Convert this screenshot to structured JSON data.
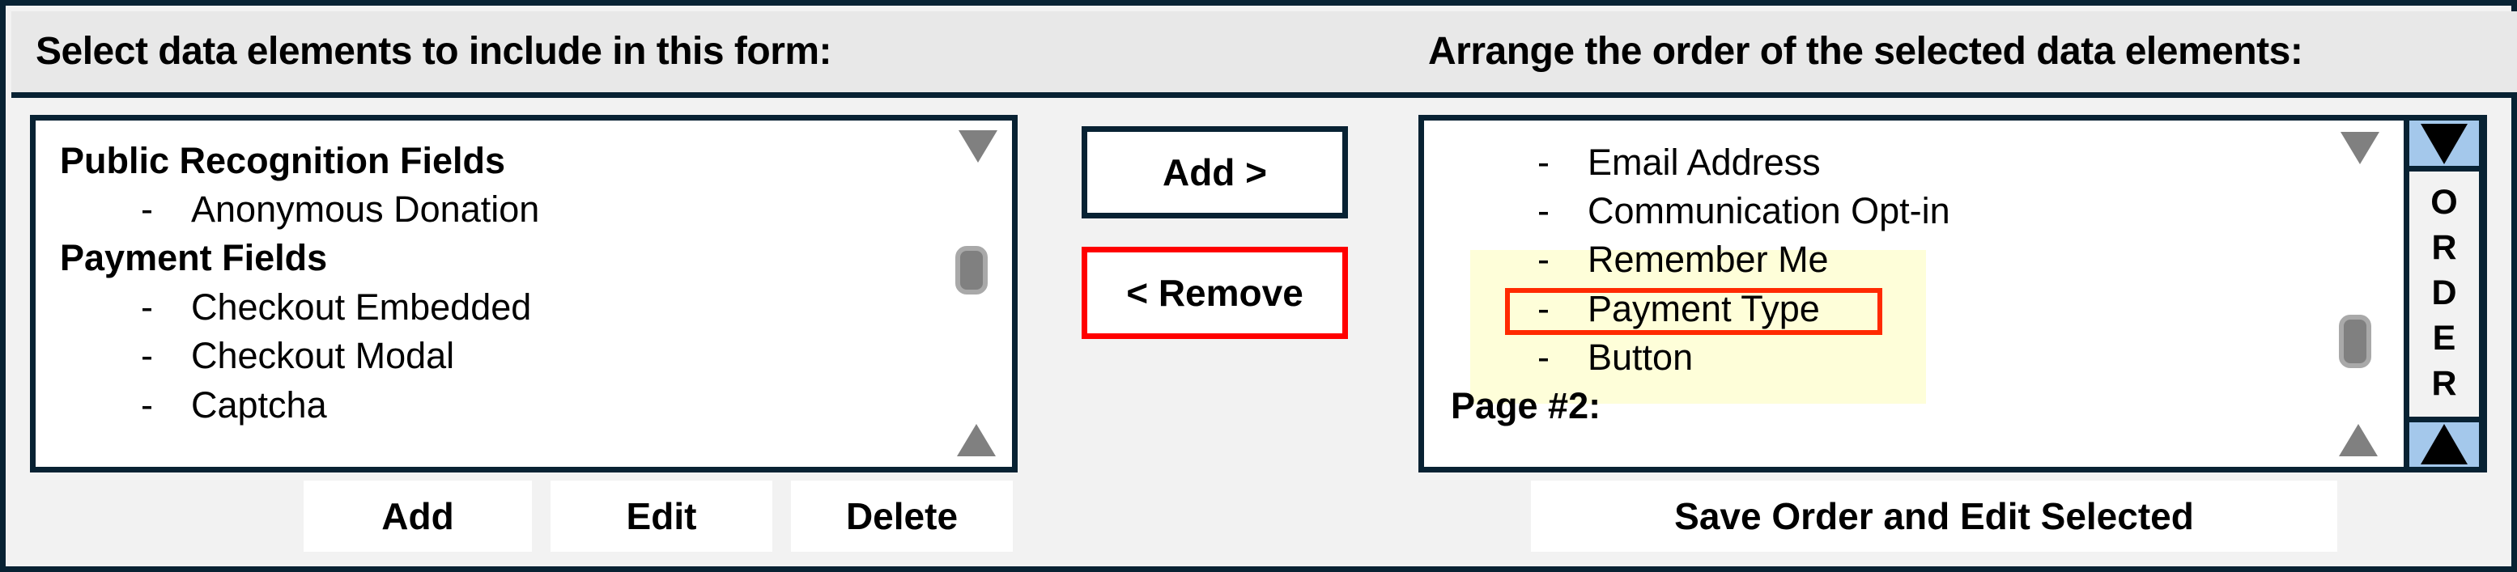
{
  "header": {
    "left_title": "Select data elements to include in this form:",
    "right_title": "Arrange the order of the selected  data elements:"
  },
  "available_list": {
    "lines": [
      {
        "type": "group",
        "label": "Public Recognition Fields"
      },
      {
        "type": "item",
        "dash": "-",
        "label": "Anonymous Donation"
      },
      {
        "type": "group",
        "label": "Payment Fields"
      },
      {
        "type": "item",
        "dash": "-",
        "label": "Checkout Embedded"
      },
      {
        "type": "item",
        "dash": "-",
        "label": "Checkout Modal"
      },
      {
        "type": "item",
        "dash": "-",
        "label": "Captcha"
      }
    ]
  },
  "transfer_buttons": {
    "add_label": "Add >",
    "remove_label": "< Remove"
  },
  "selected_list": {
    "lines": [
      {
        "type": "item",
        "dash": "-",
        "label": "Email Address"
      },
      {
        "type": "item",
        "dash": "-",
        "label": "Communication Opt-in"
      },
      {
        "type": "item",
        "dash": "-",
        "label": "Remember Me",
        "highlighted": true
      },
      {
        "type": "item",
        "dash": "-",
        "label": "Payment Type",
        "highlighted": true,
        "selected": true
      },
      {
        "type": "item",
        "dash": "-",
        "label": "Button",
        "highlighted": true
      },
      {
        "type": "group",
        "label": "Page #2:"
      }
    ]
  },
  "order_control": {
    "letters": [
      "O",
      "R",
      "D",
      "E",
      "R"
    ],
    "move_down_icon": "triangle-down",
    "move_up_icon": "triangle-up"
  },
  "left_actions": {
    "add_label": "Add",
    "edit_label": "Edit",
    "delete_label": "Delete"
  },
  "right_actions": {
    "save_label": "Save Order and Edit Selected"
  },
  "colors": {
    "frame": "#082233",
    "header_bg": "#e8e8e8",
    "body_bg": "#f2f2f2",
    "highlight_bg": "#fefed9",
    "selected_border": "#ff2a00",
    "remove_border": "#ff0000",
    "order_button_bg": "#a4c8eb",
    "scroll_gray": "#808080"
  }
}
